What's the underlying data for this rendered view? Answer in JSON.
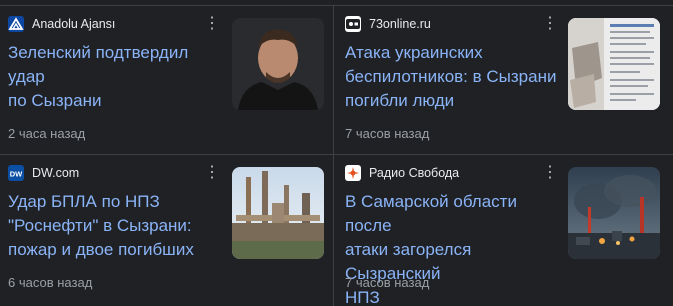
{
  "colors": {
    "background": "#202124",
    "headline": "#8ab4f8",
    "source": "#e8eaed",
    "meta": "#9aa0a6",
    "divider": "#3c4043"
  },
  "articles": [
    {
      "source": "Anadolu Ajansı",
      "icon": "anadolu-logo-icon",
      "headline_lines": [
        "Зеленский подтвердил удар",
        "по Сызрани"
      ],
      "time": "2 часа назад"
    },
    {
      "source": "73online.ru",
      "icon": "73online-logo-icon",
      "headline_lines": [
        "Атака украинских",
        "беспилотников: в Сызрани",
        "погибли люди"
      ],
      "time": "7 часов назад"
    },
    {
      "source": "DW.com",
      "icon": "dw-logo-icon",
      "headline_lines": [
        "Удар БПЛА по НПЗ",
        "\"Роснефти\" в Сызрани:",
        "пожар и двое погибших"
      ],
      "time": "6 часов назад"
    },
    {
      "source": "Радио Свобода",
      "icon": "radio-svoboda-logo-icon",
      "headline_lines": [
        "В Самарской области после",
        "атаки загорелся Сызранский",
        "НПЗ"
      ],
      "time": "7 часов назад"
    }
  ],
  "menu_icon": "⋮"
}
